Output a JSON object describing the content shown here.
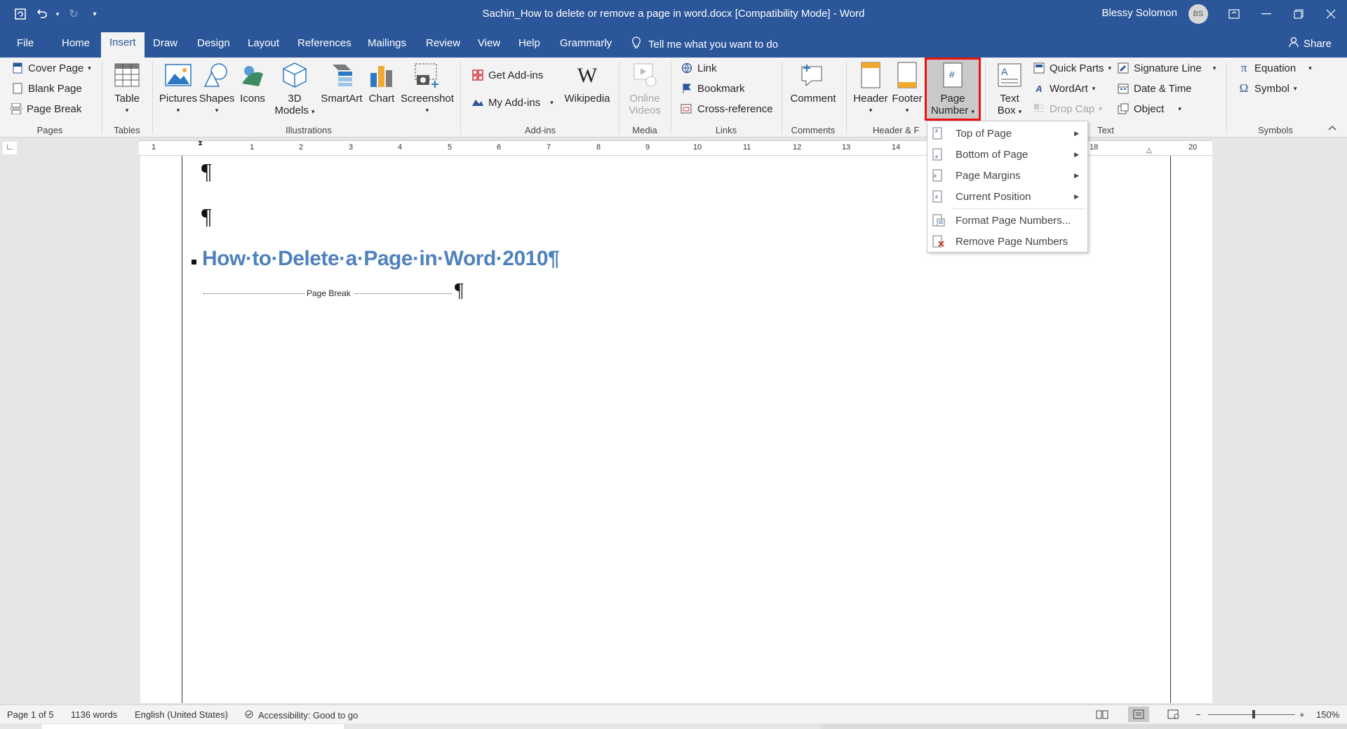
{
  "window": {
    "title": "Sachin_How to delete or remove a page in word.docx [Compatibility Mode]  -  Word",
    "user": "Blessy Solomon",
    "avatar_initials": "BS"
  },
  "tabs": [
    "File",
    "Home",
    "Insert",
    "Draw",
    "Design",
    "Layout",
    "References",
    "Mailings",
    "Review",
    "View",
    "Help",
    "Grammarly"
  ],
  "tell_me": "Tell me what you want to do",
  "share": "Share",
  "ribbon": {
    "pages": {
      "label": "Pages",
      "cover_page": "Cover Page",
      "blank_page": "Blank Page",
      "page_break": "Page Break"
    },
    "tables": {
      "label": "Tables",
      "table": "Table"
    },
    "illustrations": {
      "label": "Illustrations",
      "pictures": "Pictures",
      "shapes": "Shapes",
      "icons": "Icons",
      "models_1": "3D",
      "models_2": "Models",
      "smartart": "SmartArt",
      "chart": "Chart",
      "screenshot": "Screenshot"
    },
    "addins": {
      "label": "Add-ins",
      "get_addins": "Get Add-ins",
      "my_addins": "My Add-ins",
      "wikipedia": "Wikipedia"
    },
    "media": {
      "label": "Media",
      "online_1": "Online",
      "online_2": "Videos"
    },
    "links": {
      "label": "Links",
      "link": "Link",
      "bookmark": "Bookmark",
      "cross_reference": "Cross-reference"
    },
    "comments": {
      "label": "Comments",
      "comment": "Comment"
    },
    "header_footer": {
      "label": "Header & F",
      "header": "Header",
      "footer": "Footer",
      "page_number_1": "Page",
      "page_number_2": "Number"
    },
    "text": {
      "label": "Text",
      "textbox_1": "Text",
      "textbox_2": "Box",
      "quick_parts": "Quick Parts",
      "wordart": "WordArt",
      "drop_cap": "Drop Cap",
      "signature_line": "Signature Line",
      "date_time": "Date & Time",
      "object": "Object"
    },
    "symbols": {
      "label": "Symbols",
      "equation": "Equation",
      "symbol": "Symbol"
    }
  },
  "page_number_menu": {
    "items": [
      "Top of Page",
      "Bottom of Page",
      "Page Margins",
      "Current Position",
      "Format Page Numbers...",
      "Remove Page Numbers"
    ]
  },
  "ruler": {
    "marks": [
      "1",
      "1",
      "2",
      "3",
      "4",
      "5",
      "6",
      "7",
      "8",
      "9",
      "10",
      "11",
      "12",
      "13",
      "14",
      "18",
      "20"
    ]
  },
  "document": {
    "pilcrow": "¶",
    "heading": "How·to·Delete·a·Page·in·Word·2010¶",
    "page_break": "Page Break"
  },
  "status": {
    "page": "Page 1 of 5",
    "words": "1136 words",
    "language": "English (United States)",
    "accessibility": "Accessibility: Good to go",
    "zoom": "150%"
  },
  "colors": {
    "accent": "#2b579a",
    "heading": "#4f81bd",
    "highlight": "#ee1111"
  }
}
